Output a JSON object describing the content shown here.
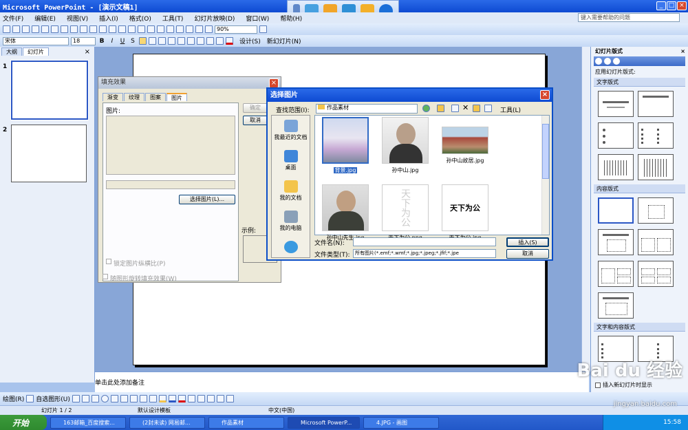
{
  "window": {
    "title": "Microsoft PowerPoint - [演示文稿1]",
    "minimize": "_",
    "restore": "□",
    "close": "×"
  },
  "menu": {
    "items": [
      "文件(F)",
      "编辑(E)",
      "视图(V)",
      "插入(I)",
      "格式(O)",
      "工具(T)",
      "幻灯片放映(D)",
      "窗口(W)",
      "帮助(H)"
    ],
    "help_placeholder": "键入需要帮助的问题"
  },
  "toolbar": {
    "zoom": "90%",
    "font": "宋体",
    "size": "18",
    "bold": "B",
    "italic": "I",
    "underline": "U",
    "shadow": "S",
    "design_label": "设计(S)",
    "new_slide_label": "新幻灯片(N)"
  },
  "left_pane": {
    "tabs": [
      "大纲",
      "幻灯片"
    ],
    "slide_numbers": [
      "1",
      "2"
    ]
  },
  "notes": {
    "placeholder": "单击此处添加备注"
  },
  "task_pane": {
    "title": "幻灯片版式",
    "apply_label": "应用幻灯片版式:",
    "sections": [
      "文字版式",
      "内容版式",
      "文字和内容版式"
    ],
    "show_label": "插入新幻灯片时显示"
  },
  "fill_dialog": {
    "title": "填充效果",
    "tabs": [
      "渐变",
      "纹理",
      "图案",
      "图片"
    ],
    "picture_label": "图片:",
    "select_button": "选择图片(L)...",
    "ok": "确定",
    "cancel": "取消",
    "sample_label": "示例:",
    "lock_ratio": "锁定图片纵横比(P)",
    "rotate_with": "随图形旋转填充效果(W)"
  },
  "picker_dialog": {
    "title": "选择图片",
    "look_in_label": "查找范围(I):",
    "look_in_value": "作品素材",
    "tools_label": "工具(L)",
    "places": [
      "我最近的文档",
      "桌面",
      "我的文档",
      "我的电脑",
      ""
    ],
    "files": [
      {
        "name": "背景.jpg",
        "selected": true
      },
      {
        "name": "孙中山.jpg"
      },
      {
        "name": "孙中山故居.jpg"
      },
      {
        "name": "孙中山先生.jpg"
      },
      {
        "name": "天下为公.png"
      },
      {
        "name": "天下为公.jpg"
      }
    ],
    "calligraphy_1": "天下为公",
    "calligraphy_2": "天下为公",
    "filename_label": "文件名(N):",
    "filetype_label": "文件类型(T):",
    "filetype_value": "所有图片(*.emf;*.wmf;*.jpg;*.jpeg;*.jfif;*.jpe",
    "insert": "插入(S)",
    "cancel": "取消"
  },
  "statusbar": {
    "slide": "幻灯片 1 / 2",
    "template": "默认设计模板",
    "language": "中文(中国)"
  },
  "drawbar": {
    "draw_label": "绘图(R)",
    "autoshape_label": "自选图形(U)"
  },
  "taskbar": {
    "start": "开始",
    "tasks": [
      "163邮箱_百度搜索...",
      "(2封未读) 网易邮...",
      "作品素材",
      "Microsoft PowerP...",
      "4.JPG - 画图"
    ],
    "time": "15:58"
  },
  "watermark": {
    "brand": "Bai du 经验",
    "url": "jingyan.baidu.com"
  }
}
